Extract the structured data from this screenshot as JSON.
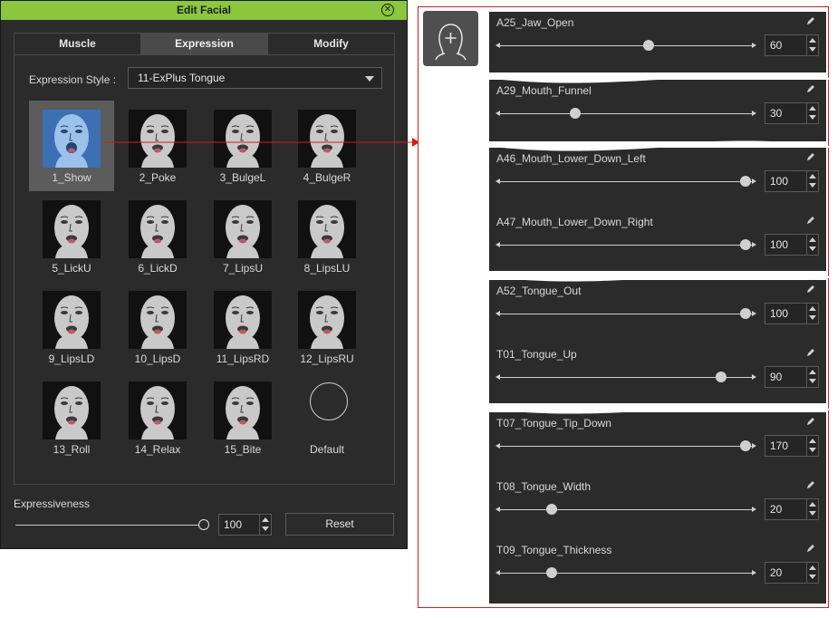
{
  "dialog": {
    "title": "Edit Facial",
    "tabs": [
      {
        "label": "Muscle",
        "active": false
      },
      {
        "label": "Expression",
        "active": true
      },
      {
        "label": "Modify",
        "active": false
      }
    ],
    "expression_style_label": "Expression Style :",
    "expression_style_value": "11-ExPlus Tongue",
    "expressions": [
      {
        "label": "1_Show",
        "selected": true
      },
      {
        "label": "2_Poke"
      },
      {
        "label": "3_BulgeL"
      },
      {
        "label": "4_BulgeR"
      },
      {
        "label": "5_LickU"
      },
      {
        "label": "6_LickD"
      },
      {
        "label": "7_LipsU"
      },
      {
        "label": "8_LipsLU"
      },
      {
        "label": "9_LipsLD"
      },
      {
        "label": "10_LipsD"
      },
      {
        "label": "11_LipsRD"
      },
      {
        "label": "12_LipsRU"
      },
      {
        "label": "13_Roll"
      },
      {
        "label": "14_Relax"
      },
      {
        "label": "15_Bite"
      },
      {
        "label": "Default",
        "is_default": true
      }
    ],
    "expressiveness_label": "Expressiveness",
    "expressiveness_value": "100",
    "expressiveness_fraction": 1.0,
    "reset_label": "Reset"
  },
  "sliders": [
    {
      "label": "A25_Jaw_Open",
      "value": "60",
      "fraction": 0.6
    },
    {
      "label": "A29_Mouth_Funnel",
      "value": "30",
      "fraction": 0.3
    },
    {
      "label": "A46_Mouth_Lower_Down_Left",
      "value": "100",
      "fraction": 1.0
    },
    {
      "label": "A47_Mouth_Lower_Down_Right",
      "value": "100",
      "fraction": 1.0
    },
    {
      "label": "A52_Tongue_Out",
      "value": "100",
      "fraction": 1.0
    },
    {
      "label": "T01_Tongue_Up",
      "value": "90",
      "fraction": 0.9
    },
    {
      "label": "T07_Tongue_Tip_Down",
      "value": "170",
      "fraction": 1.0
    },
    {
      "label": "T08_Tongue_Width",
      "value": "20",
      "fraction": 0.2
    },
    {
      "label": "T09_Tongue_Thickness",
      "value": "20",
      "fraction": 0.2
    }
  ],
  "colors": {
    "title_bar": "#8cc63f",
    "panel_bg": "#2b2b2b",
    "highlight_frame": "#d21d1d",
    "selected_thumb": "#3d6fb3"
  },
  "icons": {
    "close": "close-icon",
    "head_add": "head-add-icon",
    "pencil": "pencil-icon"
  }
}
